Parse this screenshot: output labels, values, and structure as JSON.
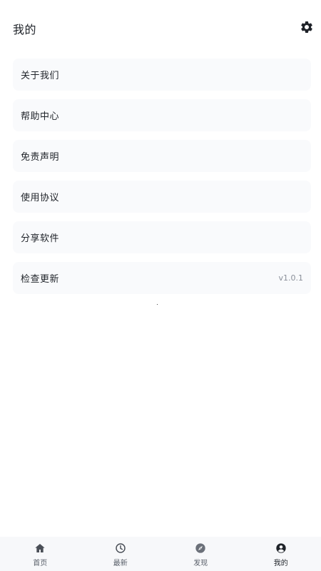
{
  "header": {
    "title": "我的",
    "settings_icon": "gear-icon"
  },
  "menu": {
    "items": [
      {
        "label": "关于我们",
        "value": ""
      },
      {
        "label": "帮助中心",
        "value": ""
      },
      {
        "label": "免责声明",
        "value": ""
      },
      {
        "label": "使用协议",
        "value": ""
      },
      {
        "label": "分享软件",
        "value": ""
      },
      {
        "label": "检查更新",
        "value": "v1.0.1"
      }
    ]
  },
  "tabbar": {
    "tabs": [
      {
        "label": "首页",
        "icon": "home-icon",
        "active": false
      },
      {
        "label": "最新",
        "icon": "clock-icon",
        "active": false
      },
      {
        "label": "发现",
        "icon": "compass-icon",
        "active": false
      },
      {
        "label": "我的",
        "icon": "user-circle-icon",
        "active": true
      }
    ]
  },
  "colors": {
    "card_background": "#f9fafc",
    "tabbar_background": "#f7f8fa",
    "icon_color": "#1f2329",
    "inactive_icon_color": "#6b7079"
  }
}
